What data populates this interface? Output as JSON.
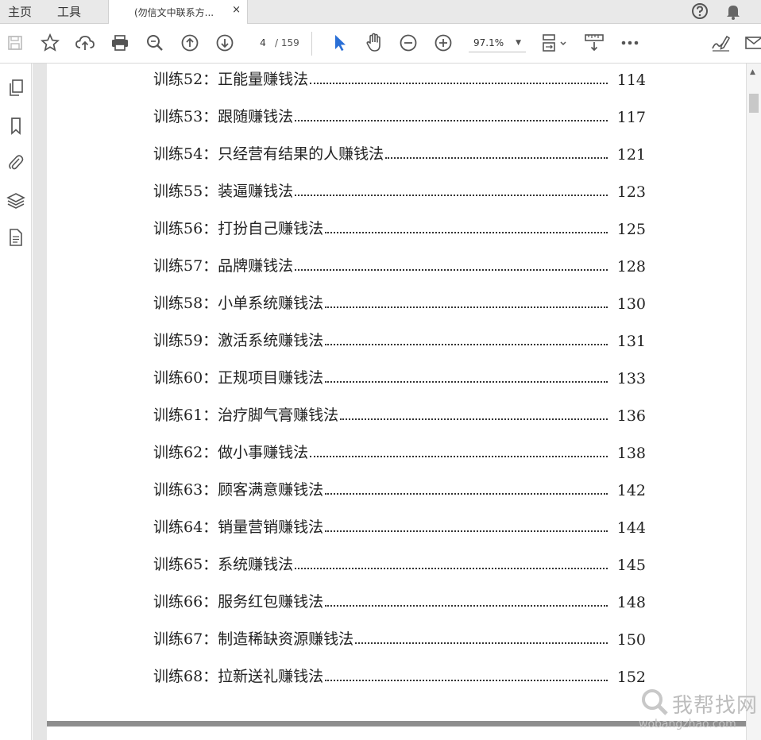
{
  "tabbar": {
    "home": "主页",
    "tools": "工具",
    "document_tab_title": "(勿信文中联系方...",
    "close_glyph": "×"
  },
  "toolbar": {
    "current_page": "4",
    "total_pages": "/ 159",
    "zoom": "97.1%"
  },
  "toc": [
    {
      "label": "训练52：正能量赚钱法",
      "page": "114"
    },
    {
      "label": "训练53：跟随赚钱法",
      "page": "117"
    },
    {
      "label": "训练54：只经营有结果的人赚钱法",
      "page": "121"
    },
    {
      "label": "训练55：装逼赚钱法",
      "page": "123"
    },
    {
      "label": "训练56：打扮自己赚钱法",
      "page": "125"
    },
    {
      "label": "训练57：品牌赚钱法",
      "page": "128"
    },
    {
      "label": "训练58：小单系统赚钱法",
      "page": "130"
    },
    {
      "label": "训练59：激活系统赚钱法",
      "page": "131"
    },
    {
      "label": "训练60：正规项目赚钱法",
      "page": "133"
    },
    {
      "label": "训练61：治疗脚气膏赚钱法",
      "page": "136"
    },
    {
      "label": "训练62：做小事赚钱法",
      "page": "138"
    },
    {
      "label": "训练63：顾客满意赚钱法",
      "page": "142"
    },
    {
      "label": "训练64：销量营销赚钱法",
      "page": "144"
    },
    {
      "label": "训练65：系统赚钱法",
      "page": "145"
    },
    {
      "label": "训练66：服务红包赚钱法",
      "page": "148"
    },
    {
      "label": "训练67：制造稀缺资源赚钱法",
      "page": "150"
    },
    {
      "label": "训练68：拉新送礼赚钱法",
      "page": "152"
    }
  ],
  "watermark": {
    "text": "我帮找网",
    "url": "wobangzhao.com"
  },
  "colors": {
    "accent": "#2a6fd6",
    "icon": "#555555",
    "tabbar_bg": "#e9e9e9",
    "page_separator": "#8e8e8e"
  },
  "icons": {
    "toolbar": [
      "save-icon",
      "bookmark-star-icon",
      "upload-cloud-icon",
      "print-icon",
      "zoom-search-icon",
      "page-up-icon",
      "page-down-icon",
      "select-cursor-icon",
      "hand-tool-icon",
      "zoom-out-icon",
      "zoom-in-icon",
      "fit-page-icon",
      "measure-icon",
      "more-icon",
      "sign-icon",
      "mail-icon"
    ],
    "left_panel": [
      "pages-thumbnail-icon",
      "bookmarks-icon",
      "attachments-icon",
      "layers-icon",
      "document-properties-icon"
    ],
    "tabbar": [
      "help-icon",
      "bell-icon"
    ]
  }
}
